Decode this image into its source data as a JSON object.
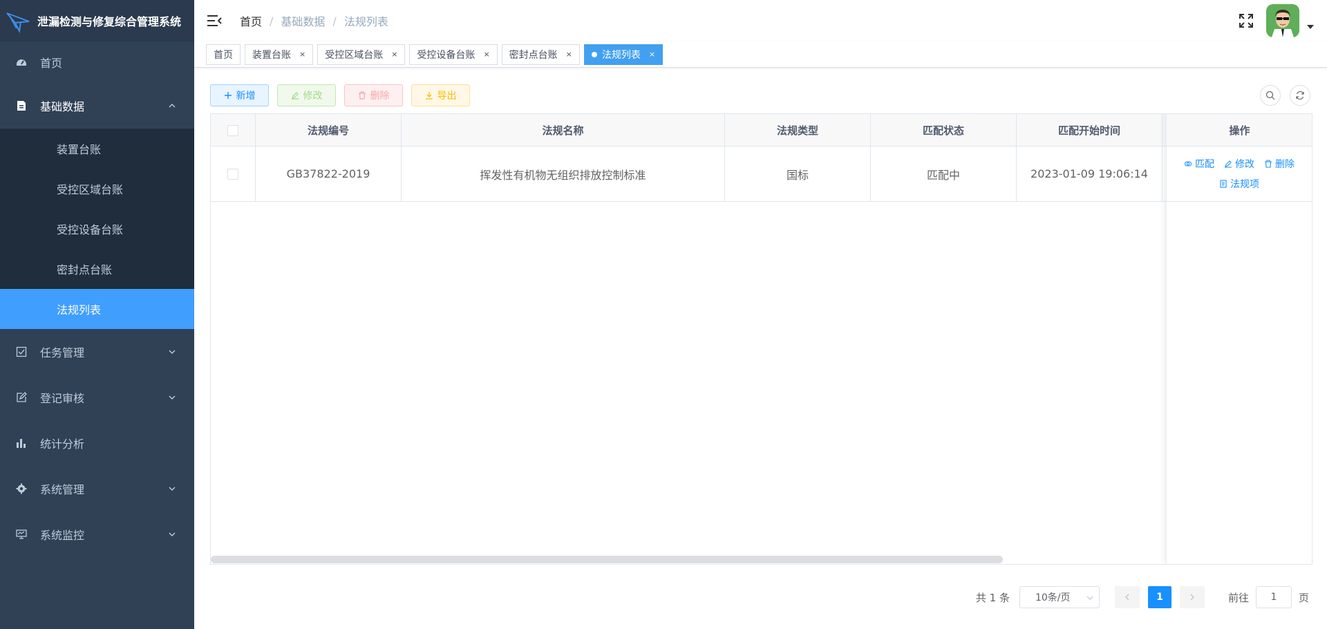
{
  "app": {
    "title": "泄漏检测与修复综合管理系统"
  },
  "sidebar": {
    "items": [
      {
        "label": "首页",
        "icon": "dashboard-icon"
      },
      {
        "label": "基础数据",
        "icon": "document-icon",
        "open": true,
        "children": [
          "装置台账",
          "受控区域台账",
          "受控设备台账",
          "密封点台账",
          "法规列表"
        ],
        "active_child": "法规列表"
      },
      {
        "label": "任务管理",
        "icon": "checkbox-icon"
      },
      {
        "label": "登记审核",
        "icon": "edit-icon"
      },
      {
        "label": "统计分析",
        "icon": "bar-chart-icon"
      },
      {
        "label": "系统管理",
        "icon": "gear-icon"
      },
      {
        "label": "系统监控",
        "icon": "monitor-icon"
      }
    ]
  },
  "navbar": {
    "breadcrumb": [
      "首页",
      "基础数据",
      "法规列表"
    ]
  },
  "tags": [
    {
      "label": "首页",
      "closable": false
    },
    {
      "label": "装置台账",
      "closable": true
    },
    {
      "label": "受控区域台账",
      "closable": true
    },
    {
      "label": "受控设备台账",
      "closable": true
    },
    {
      "label": "密封点台账",
      "closable": true
    },
    {
      "label": "法规列表",
      "closable": true,
      "active": true
    }
  ],
  "toolbar": {
    "add_label": "新增",
    "edit_label": "修改",
    "delete_label": "删除",
    "export_label": "导出"
  },
  "table": {
    "columns": [
      "法规编号",
      "法规名称",
      "法规类型",
      "匹配状态",
      "匹配开始时间",
      "操作"
    ],
    "rows": [
      {
        "code": "GB37822-2019",
        "name": "挥发性有机物无组织排放控制标准",
        "type": "国标",
        "status": "匹配中",
        "start_time": "2023-01-09 19:06:14"
      }
    ],
    "actions": {
      "match": "匹配",
      "edit": "修改",
      "delete": "删除",
      "items": "法规项"
    }
  },
  "pagination": {
    "total_text": "共 1 条",
    "page_size": "10条/页",
    "current_page": "1",
    "goto_prefix": "前往",
    "goto_value": "1",
    "goto_suffix": "页"
  },
  "colors": {
    "sidebar_bg": "#304156",
    "primary": "#1890ff",
    "active_menu": "#409eff"
  }
}
